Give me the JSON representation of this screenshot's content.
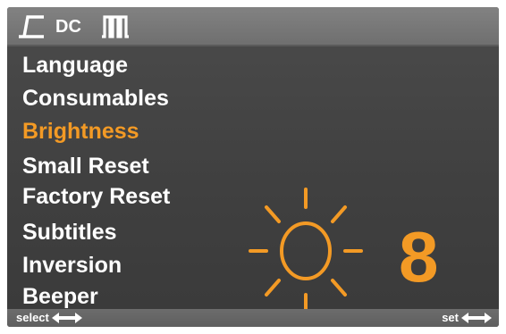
{
  "header": {
    "mode_icons": [
      "step-wave-icon",
      "pulse-train-icon"
    ],
    "dc_label": "DC"
  },
  "menu": {
    "items": [
      {
        "label": "Language",
        "active": false
      },
      {
        "label": "Consumables",
        "active": false
      },
      {
        "label": "Brightness",
        "active": true
      },
      {
        "label": "Small Reset",
        "active": false
      },
      {
        "label": "Factory Reset",
        "active": false
      },
      {
        "label": "Subtitles",
        "active": false
      },
      {
        "label": "Inversion",
        "active": false
      },
      {
        "label": "Beeper",
        "active": false
      }
    ]
  },
  "setting": {
    "icon": "sun-icon",
    "value": "8"
  },
  "footer": {
    "left_hint": "select",
    "right_hint": "set",
    "arrow_icon": "left-right-arrow-icon"
  },
  "colors": {
    "accent": "#f39a25",
    "text": "#ffffff",
    "background": "#444444",
    "bar": "#777777"
  }
}
